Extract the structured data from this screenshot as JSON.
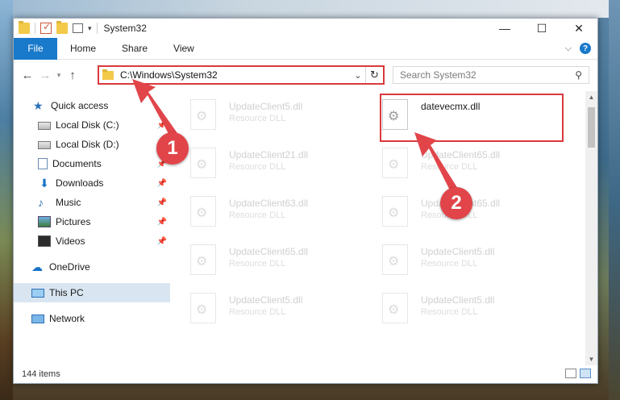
{
  "window": {
    "title": "System32",
    "controls": {
      "minimize": "—",
      "maximize": "☐",
      "close": "✕"
    }
  },
  "ribbon": {
    "tabs": [
      "File",
      "Home",
      "Share",
      "View"
    ],
    "collapse": "⌵",
    "help": "?"
  },
  "address": {
    "path": "C:\\Windows\\System32",
    "search_placeholder": "Search System32"
  },
  "sidebar": {
    "items": [
      {
        "label": "Quick access",
        "icon": "star-icon",
        "pinned": false
      },
      {
        "label": "Local Disk (C:)",
        "icon": "disk-icon",
        "pinned": true
      },
      {
        "label": "Local Disk (D:)",
        "icon": "disk-icon",
        "pinned": false
      },
      {
        "label": "Documents",
        "icon": "documents-icon",
        "pinned": true
      },
      {
        "label": "Downloads",
        "icon": "downloads-icon",
        "pinned": true
      },
      {
        "label": "Music",
        "icon": "music-icon",
        "pinned": true
      },
      {
        "label": "Pictures",
        "icon": "pictures-icon",
        "pinned": true
      },
      {
        "label": "Videos",
        "icon": "videos-icon",
        "pinned": true
      },
      {
        "label": "OneDrive",
        "icon": "onedrive-icon",
        "pinned": false
      },
      {
        "label": "This PC",
        "icon": "this-pc-icon",
        "pinned": false,
        "selected": true
      },
      {
        "label": "Network",
        "icon": "network-icon",
        "pinned": false
      }
    ]
  },
  "files": [
    {
      "name": "UpdateClient5.dll",
      "type": "Resource DLL",
      "faded": true
    },
    {
      "name": "datevecmx.dll",
      "type": "",
      "faded": false
    },
    {
      "name": "UpdateClient21.dll",
      "type": "Resource DLL",
      "faded": true
    },
    {
      "name": "UpdateClient65.dll",
      "type": "Resource DLL",
      "faded": true
    },
    {
      "name": "UpdateClient63.dll",
      "type": "Resource DLL",
      "faded": true
    },
    {
      "name": "UpdateClient65.dll",
      "type": "Resource DLL",
      "faded": true
    },
    {
      "name": "UpdateClient65.dll",
      "type": "Resource DLL",
      "faded": true
    },
    {
      "name": "UpdateClient5.dll",
      "type": "Resource DLL",
      "faded": true
    },
    {
      "name": "UpdateClient5.dll",
      "type": "Resource DLL",
      "faded": true
    },
    {
      "name": "UpdateClient5.dll",
      "type": "Resource DLL",
      "faded": true
    }
  ],
  "status": {
    "count": "144 items"
  },
  "annotations": {
    "badge1": "1",
    "badge2": "2",
    "color": "#e1454a"
  }
}
